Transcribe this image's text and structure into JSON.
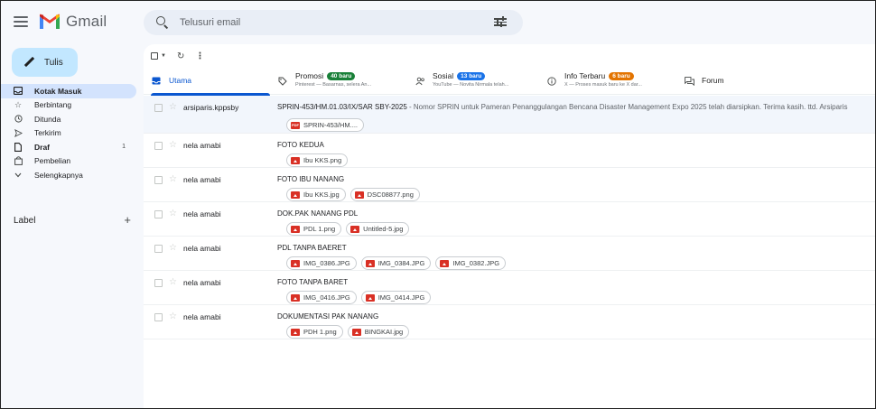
{
  "header": {
    "app_name": "Gmail",
    "search_placeholder": "Telusuri email"
  },
  "sidebar": {
    "compose_label": "Tulis",
    "items": [
      {
        "label": "Kotak Masuk",
        "icon": "inbox-icon",
        "active": true
      },
      {
        "label": "Berbintang",
        "icon": "star-icon"
      },
      {
        "label": "Ditunda",
        "icon": "clock-icon"
      },
      {
        "label": "Terkirim",
        "icon": "send-icon"
      },
      {
        "label": "Draf",
        "icon": "draft-icon",
        "count": "1"
      },
      {
        "label": "Pembelian",
        "icon": "bag-icon"
      },
      {
        "label": "Selengkapnya",
        "icon": "chevron-down-icon"
      }
    ],
    "labels_title": "Label"
  },
  "tabs": [
    {
      "name": "Utama",
      "icon": "inbox-icon",
      "active": true
    },
    {
      "name": "Promosi",
      "icon": "tag-icon",
      "badge": "40 baru",
      "badge_color": "#188038",
      "sub": "Pinterest — Basarnas, selera An..."
    },
    {
      "name": "Sosial",
      "icon": "people-icon",
      "badge": "13 baru",
      "badge_color": "#1a73e8",
      "sub": "YouTube — Novita Nirmala telah..."
    },
    {
      "name": "Info Terbaru",
      "icon": "info-icon",
      "badge": "6 baru",
      "badge_color": "#e37400",
      "sub": "X — Proses masuk baru ke X dar..."
    },
    {
      "name": "Forum",
      "icon": "forum-icon"
    }
  ],
  "emails": [
    {
      "sender": "arsiparis.kppsby",
      "subject": "SPRIN-453/HM.01.03/IX/SAR SBY-2025",
      "snippet": " - Nomor SPRIN untuk Pameran Penanggulangan Bencana Disaster Management Expo 2025 telah diarsipkan. Terima kasih. ttd. Arsiparis",
      "attachments": [
        {
          "name": "SPRIN-453/HM....",
          "type": "pdf"
        }
      ]
    },
    {
      "sender": "nela amabi",
      "subject": "FOTO KEDUA",
      "snippet": "",
      "attachments": [
        {
          "name": "Ibu KKS.png",
          "type": "img"
        }
      ]
    },
    {
      "sender": "nela amabi",
      "subject": "FOTO IBU NANANG",
      "snippet": "",
      "attachments": [
        {
          "name": "Ibu KKS.jpg",
          "type": "img"
        },
        {
          "name": "DSC08877.png",
          "type": "img"
        }
      ]
    },
    {
      "sender": "nela amabi",
      "subject": "DOK.PAK NANANG PDL",
      "snippet": "",
      "attachments": [
        {
          "name": "PDL 1.png",
          "type": "img"
        },
        {
          "name": "Untitled-5.jpg",
          "type": "img"
        }
      ]
    },
    {
      "sender": "nela amabi",
      "subject": "PDL TANPA BAERET",
      "snippet": "",
      "attachments": [
        {
          "name": "IMG_0386.JPG",
          "type": "img"
        },
        {
          "name": "IMG_0384.JPG",
          "type": "img"
        },
        {
          "name": "IMG_0382.JPG",
          "type": "img"
        }
      ]
    },
    {
      "sender": "nela amabi",
      "subject": "FOTO TANPA BARET",
      "snippet": "",
      "attachments": [
        {
          "name": "IMG_0416.JPG",
          "type": "img"
        },
        {
          "name": "IMG_0414.JPG",
          "type": "img"
        }
      ]
    },
    {
      "sender": "nela amabi",
      "subject": "DOKUMENTASI PAK NANANG",
      "snippet": "",
      "attachments": [
        {
          "name": "PDH 1.png",
          "type": "img"
        },
        {
          "name": "BINGKAI.jpg",
          "type": "img"
        }
      ]
    }
  ],
  "colors": {
    "accent": "#0b57d0",
    "compose_bg": "#c2e7ff",
    "active_nav_bg": "#d3e3fd"
  }
}
